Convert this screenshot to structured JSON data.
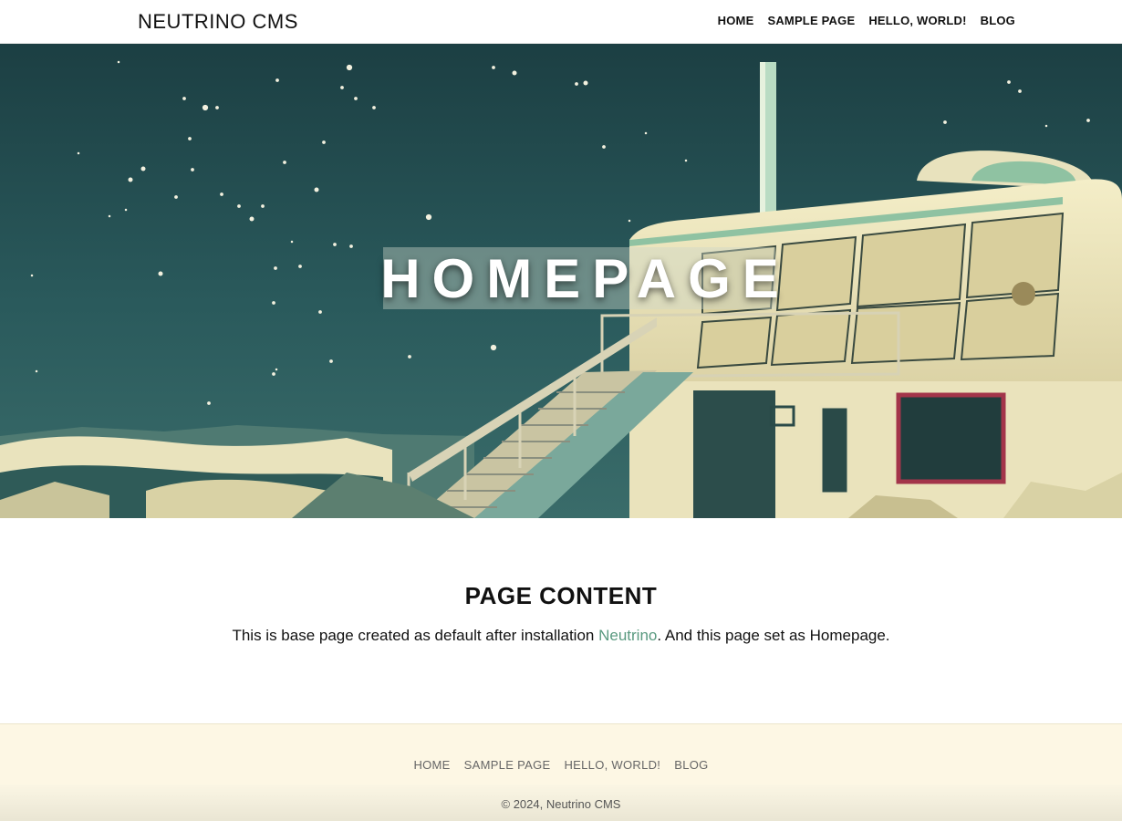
{
  "header": {
    "brand": "NEUTRINO CMS",
    "nav": [
      "HOME",
      "SAMPLE PAGE",
      "HELLO, WORLD!",
      "BLOG"
    ]
  },
  "hero": {
    "title": "HOMEPAGE"
  },
  "content": {
    "heading": "PAGE CONTENT",
    "text_before": "This is base page created as default after installation ",
    "link_text": "Neutrino",
    "text_after": ". And this page set as Homepage."
  },
  "footer": {
    "nav": [
      "HOME",
      "SAMPLE PAGE",
      "HELLO, WORLD!",
      "BLOG"
    ],
    "copyright": "© 2024, Neutrino CMS"
  },
  "colors": {
    "accent_link": "#5a9a80",
    "footer_bg": "#fdf7e4",
    "hero_sky": "#1f4446"
  }
}
